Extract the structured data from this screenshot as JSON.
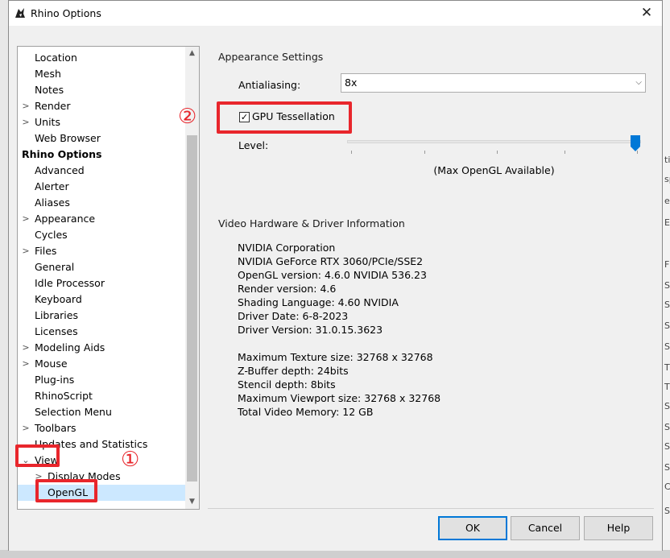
{
  "window": {
    "title": "Rhino Options",
    "icon": "rhino-app-icon",
    "close_glyph": "✕"
  },
  "tree": {
    "items": [
      {
        "label": "Location",
        "expander": ""
      },
      {
        "label": "Mesh",
        "expander": ""
      },
      {
        "label": "Notes",
        "expander": ""
      },
      {
        "label": "Render",
        "expander": ">"
      },
      {
        "label": "Units",
        "expander": ">"
      },
      {
        "label": "Web Browser",
        "expander": ""
      },
      {
        "label": "Rhino Options",
        "expander": ""
      },
      {
        "label": "Advanced",
        "expander": ""
      },
      {
        "label": "Alerter",
        "expander": ""
      },
      {
        "label": "Aliases",
        "expander": ""
      },
      {
        "label": "Appearance",
        "expander": ">"
      },
      {
        "label": "Cycles",
        "expander": ""
      },
      {
        "label": "Files",
        "expander": ">"
      },
      {
        "label": "General",
        "expander": ""
      },
      {
        "label": "Idle Processor",
        "expander": ""
      },
      {
        "label": "Keyboard",
        "expander": ""
      },
      {
        "label": "Libraries",
        "expander": ""
      },
      {
        "label": "Licenses",
        "expander": ""
      },
      {
        "label": "Modeling Aids",
        "expander": ">"
      },
      {
        "label": "Mouse",
        "expander": ">"
      },
      {
        "label": "Plug-ins",
        "expander": ""
      },
      {
        "label": "RhinoScript",
        "expander": ""
      },
      {
        "label": "Selection Menu",
        "expander": ""
      },
      {
        "label": "Toolbars",
        "expander": ">"
      },
      {
        "label": "Updates and Statistics",
        "expander": ""
      },
      {
        "label": "View",
        "expander": "⌄"
      },
      {
        "label": "Display Modes",
        "expander": ">"
      },
      {
        "label": "OpenGL",
        "expander": ""
      }
    ],
    "selected": "OpenGL",
    "scroll_up": "▲",
    "scroll_down": "▼"
  },
  "appearance": {
    "heading": "Appearance Settings",
    "antialiasing_label": "Antialiasing:",
    "antialiasing_value": "8x",
    "gpu_tessellation_label": "GPU Tessellation",
    "gpu_tessellation_checked": true,
    "check_glyph": "✓",
    "level_label": "Level:",
    "level_fraction": 1.0,
    "level_note": "(Max OpenGL Available)"
  },
  "video": {
    "heading": "Video Hardware & Driver Information",
    "lines": [
      "NVIDIA Corporation",
      "NVIDIA GeForce RTX 3060/PCIe/SSE2",
      "OpenGL version: 4.6.0 NVIDIA 536.23",
      "Render version: 4.6",
      "Shading Language: 4.60 NVIDIA",
      "Driver Date: 6-8-2023",
      "Driver Version: 31.0.15.3623",
      "",
      "Maximum Texture size: 32768 x 32768",
      "Z-Buffer depth: 24bits",
      "Stencil depth: 8bits",
      "Maximum Viewport size: 32768 x 32768",
      "Total Video Memory: 12 GB"
    ]
  },
  "buttons": {
    "ok": "OK",
    "cancel": "Cancel",
    "help": "Help"
  },
  "annotations": {
    "step1": "①",
    "step2": "②",
    "color": "#e8262c"
  },
  "background_app": {
    "right_edge_glyphs": [
      "ti",
      "sp",
      "er",
      "E",
      "F",
      "S",
      "S",
      "S",
      "S",
      "T",
      "T",
      "S",
      "S",
      "S",
      "S",
      "C",
      "S"
    ]
  }
}
